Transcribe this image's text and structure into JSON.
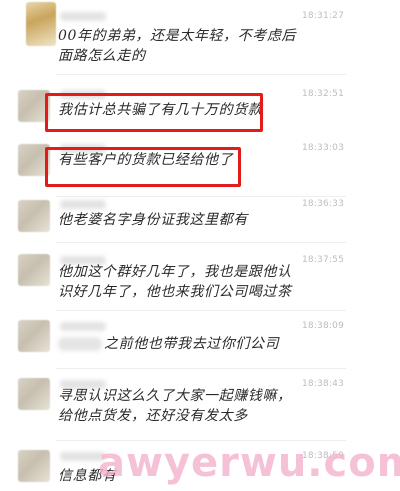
{
  "messages": [
    {
      "time": "18:31:27",
      "text": "00年的弟弟，还是太年轻，不考虑后面路怎么走的"
    },
    {
      "time": "18:32:51",
      "text": "我估计总共骗了有几十万的货款"
    },
    {
      "time": "18:33:03",
      "text": "有些客户的货款已经给他了"
    },
    {
      "time": "18:36:33",
      "text": "他老婆名字身份证我这里都有"
    },
    {
      "time": "18:37:55",
      "text": "他加这个群好几年了，我也是跟他认识好几年了，他也来我们公司喝过茶"
    },
    {
      "time": "18:38:09",
      "text": "之前他也带我去过你们公司"
    },
    {
      "time": "18:38:43",
      "text": "寻思认识这么久了大家一起赚钱嘛，给他点货发，还好没有发太多"
    },
    {
      "time": "18:38:59",
      "text": "信息都有"
    }
  ],
  "watermark": "awyerwu.com",
  "colors": {
    "highlight": "#e21b1b",
    "watermark": "#f4b4cf"
  }
}
